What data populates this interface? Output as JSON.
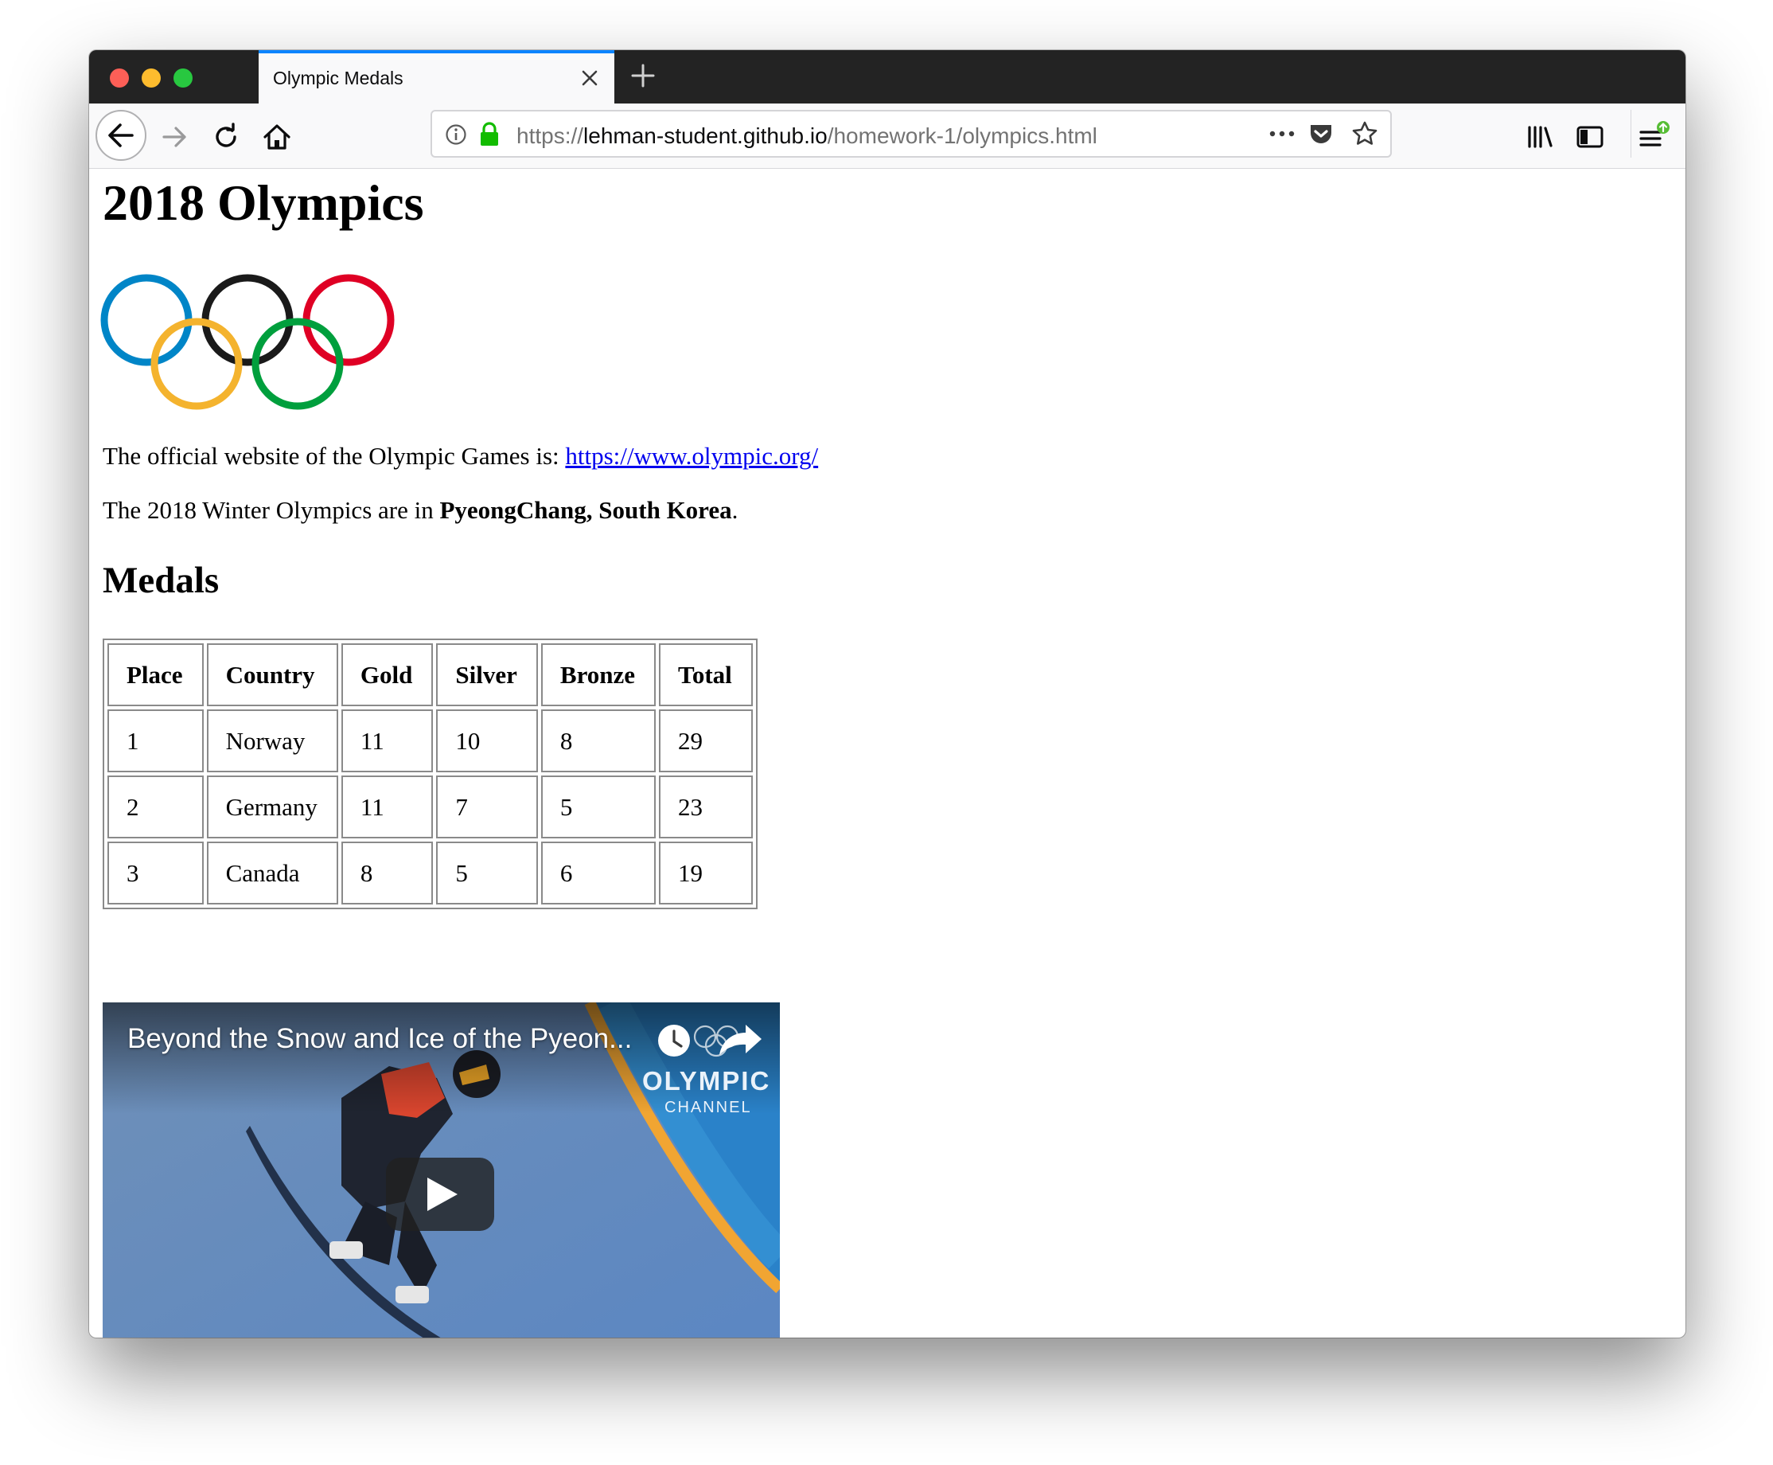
{
  "browser": {
    "tab_title": "Olympic Medals",
    "url": {
      "scheme": "https://",
      "host": "lehman-student.github.io",
      "path": "/homework-1/olympics.html"
    }
  },
  "page": {
    "title": "2018 Olympics",
    "official_site_text": "The official website of the Olympic Games is: ",
    "official_site_link": "https://www.olympic.org/",
    "location_prefix": "The 2018 Winter Olympics are in ",
    "location": "PyeongChang, South Korea",
    "location_suffix": ".",
    "medals_heading": "Medals",
    "medals_table": {
      "headers": [
        "Place",
        "Country",
        "Gold",
        "Silver",
        "Bronze",
        "Total"
      ],
      "rows": [
        [
          "1",
          "Norway",
          "11",
          "10",
          "8",
          "29"
        ],
        [
          "2",
          "Germany",
          "11",
          "7",
          "5",
          "23"
        ],
        [
          "3",
          "Canada",
          "8",
          "5",
          "6",
          "19"
        ]
      ]
    },
    "video": {
      "title": "Beyond the Snow and Ice of the Pyeon...",
      "brand_line1": "OLYMPIC",
      "brand_line2": "CHANNEL"
    }
  },
  "colors": {
    "link": "#0000ee",
    "tab_accent": "#0a84ff",
    "ring_blue": "#0085c7",
    "ring_yellow": "#f4c300",
    "ring_black": "#000000",
    "ring_green": "#009f3d",
    "ring_red": "#df0024"
  }
}
